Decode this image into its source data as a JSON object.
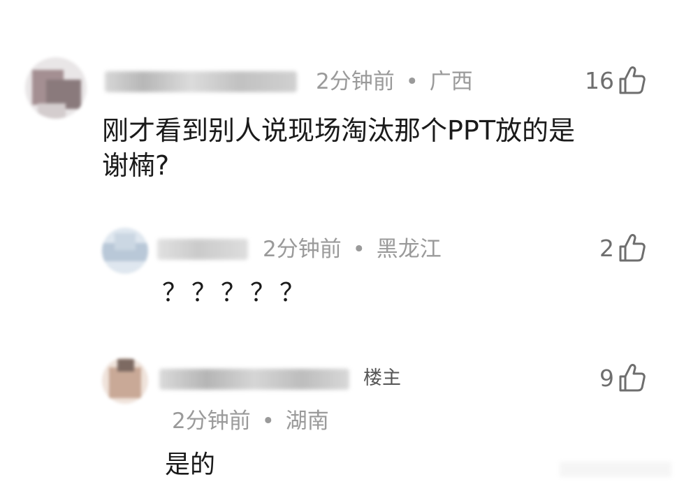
{
  "comments": [
    {
      "time": "2分钟前",
      "location": "广西",
      "text_line1": "刚才看到别人说现场淘汰那个PPT放的是",
      "text_line2": "谢楠?",
      "likes": "16",
      "avatar_color": "#8a7a7c"
    },
    {
      "time": "2分钟前",
      "location": "黑龙江",
      "text": "？？？？？",
      "likes": "2",
      "avatar_color": "#b9c8d8"
    },
    {
      "time": "2分钟前",
      "location": "湖南",
      "badge": "楼主",
      "text": "是的",
      "likes": "9",
      "avatar_color": "#c9a997"
    }
  ],
  "separator": "•",
  "icons": {
    "like": "thumbs-up-icon"
  },
  "colors": {
    "meta_text": "#9a9a9a",
    "body_text": "#1a1a1a",
    "like_text": "#6e6e6e"
  }
}
